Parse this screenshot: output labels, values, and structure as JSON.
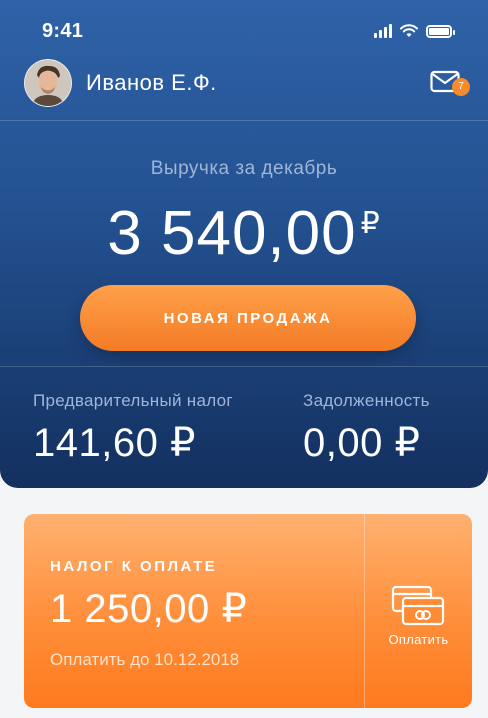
{
  "status_bar": {
    "time": "9:41"
  },
  "header": {
    "user_name": "Иванов Е.Ф.",
    "mail_badge": "7"
  },
  "revenue": {
    "label": "Выручка за декабрь",
    "amount": "3 540,00",
    "currency": "₽"
  },
  "new_sale_button": {
    "label": "НОВАЯ ПРОДАЖА"
  },
  "stats": [
    {
      "label": "Предварительный налог",
      "value": "141,60 ₽"
    },
    {
      "label": "Задолженность",
      "value": "0,00 ₽"
    }
  ],
  "tax_card": {
    "title": "НАЛОГ К ОПЛАТЕ",
    "amount": "1 250,00 ₽",
    "due": "Оплатить до 10.12.2018",
    "pay_label": "Оплатить"
  },
  "colors": {
    "hero_top": "#2f62a8",
    "hero_bottom": "#13305f",
    "accent_orange": "#f47b25",
    "muted_label": "#9fb6d8"
  },
  "icons": {
    "mail": "envelope-icon",
    "pay": "credit-card-icon"
  }
}
